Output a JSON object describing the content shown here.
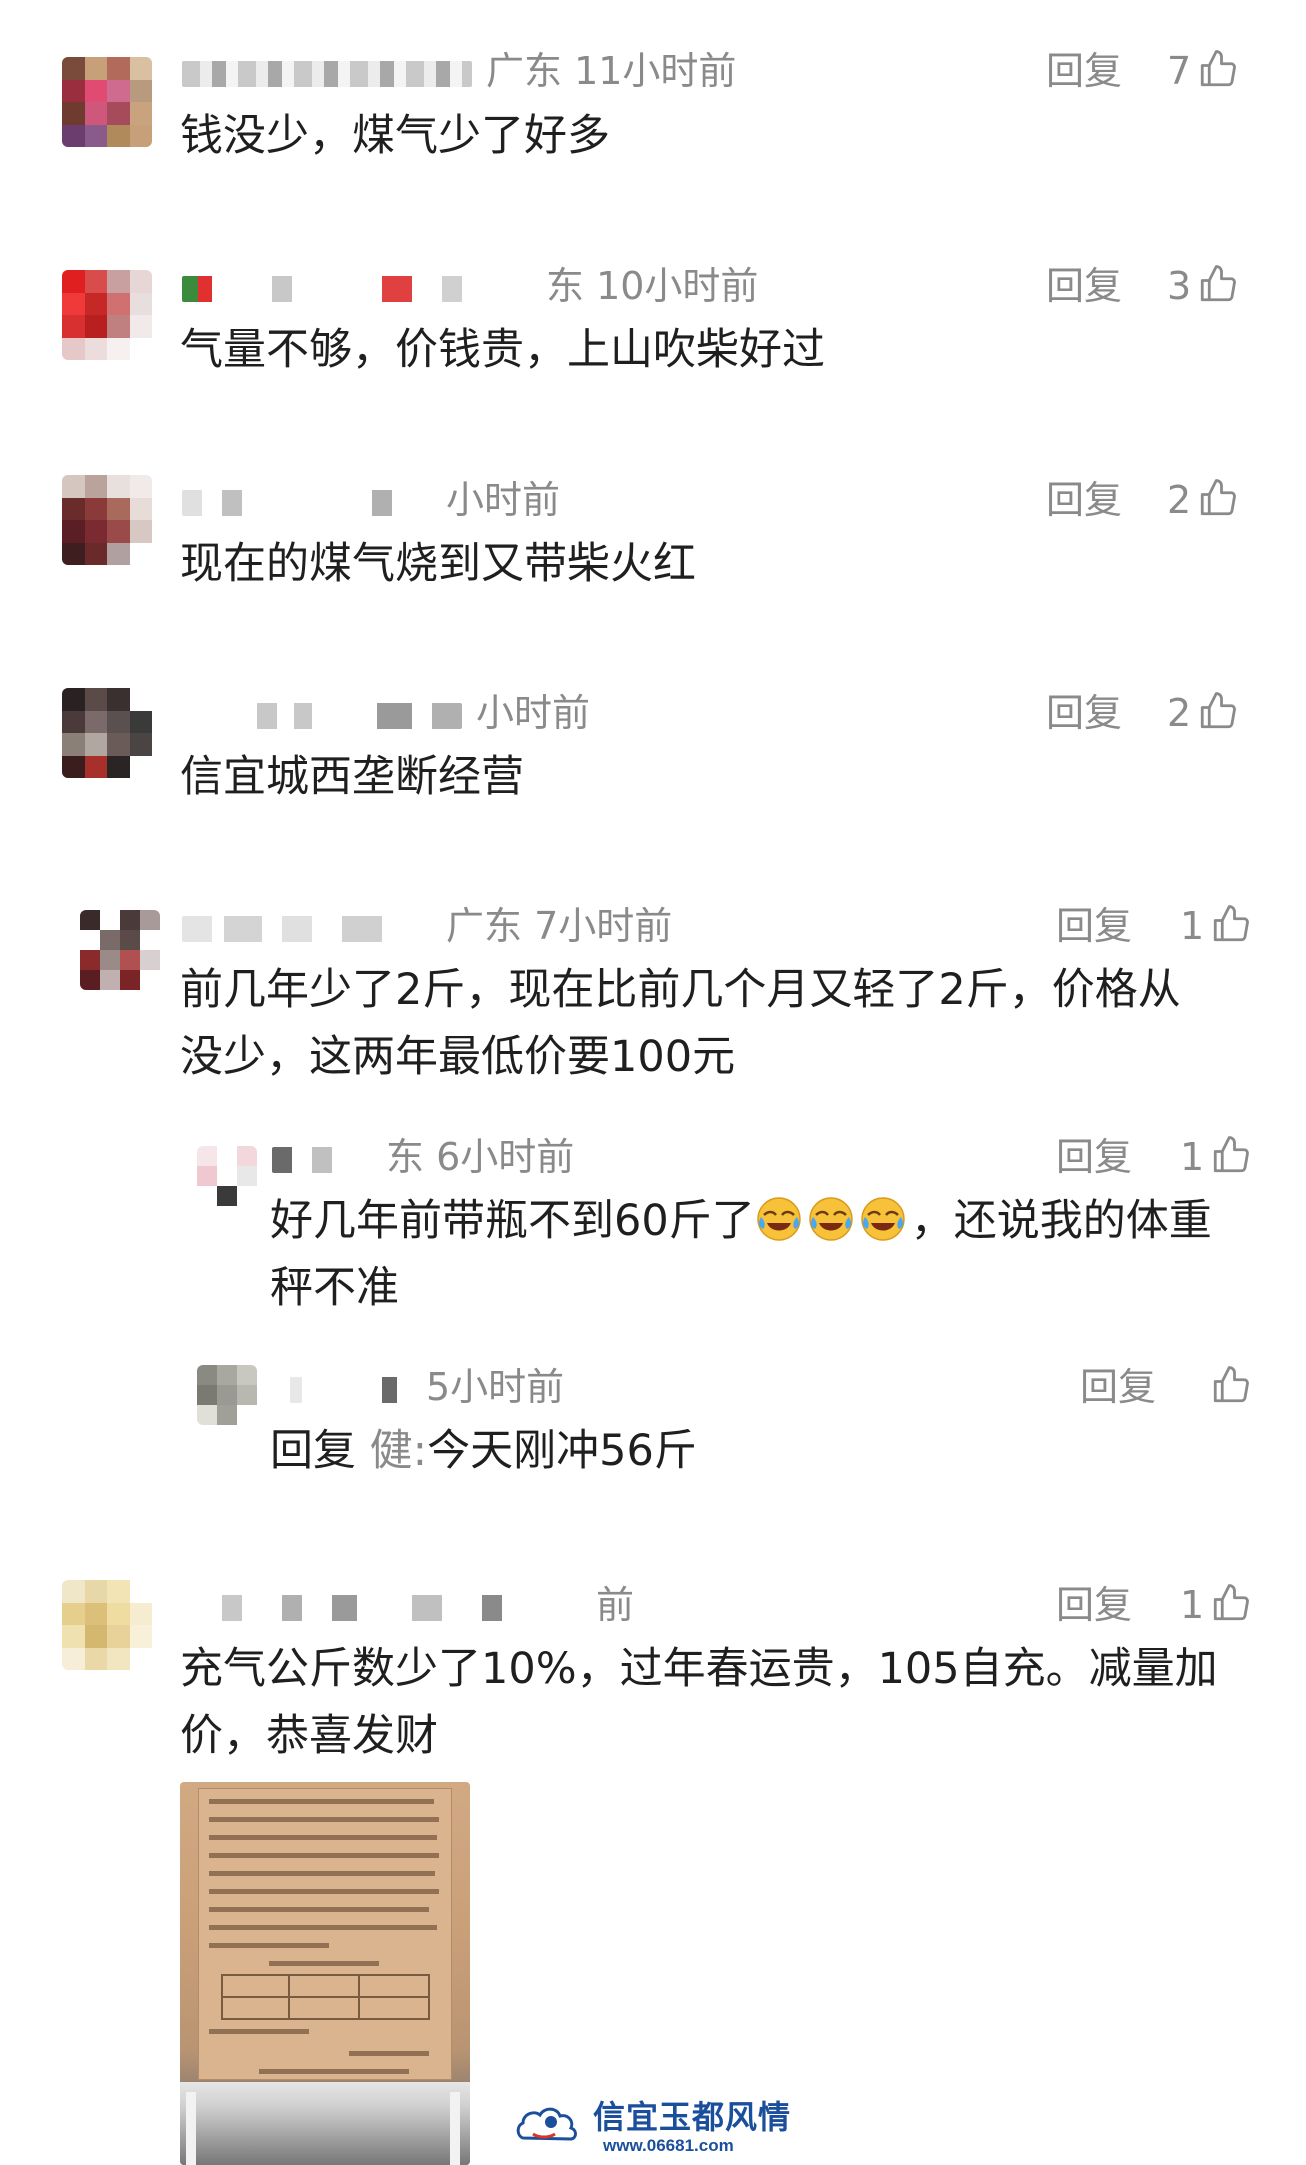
{
  "ui": {
    "reply_label": "回复"
  },
  "comments": [
    {
      "meta": "广东 11小时前",
      "likes": "7",
      "text": "钱没少，煤气少了好多"
    },
    {
      "meta": "东 10小时前",
      "likes": "3",
      "text": "气量不够，价钱贵，上山吹柴好过"
    },
    {
      "meta": "小时前",
      "likes": "2",
      "text": "现在的煤气烧到又带柴火红"
    },
    {
      "meta": "小时前",
      "likes": "2",
      "text": "信宜城西垄断经营"
    },
    {
      "meta": "广东 7小时前",
      "likes": "1",
      "text_line1": "前几年少了2斤，现在比前几个月又轻了2斤，价格从",
      "text_line2": "没少，这两年最低价要100元",
      "replies": [
        {
          "meta": "东 6小时前",
          "likes": "1",
          "text_line1_before": "好几年前带瓶不到60斤了",
          "emoji": "crying-laughing",
          "emoji_count": 3,
          "text_line1_after": "，还说我的体重",
          "text_line2": "秤不准"
        },
        {
          "meta": "5小时前",
          "likes": "",
          "reply_prefix": "回复",
          "reply_target": "健:",
          "text": "今天刚冲56斤"
        }
      ]
    },
    {
      "meta": "前",
      "likes": "1",
      "text_line1": "充气公斤数少了10%，过年春运贵，105自充。减量加",
      "text_line2": "价，恭喜发财"
    }
  ],
  "watermark": {
    "title": "信宜玉都风情",
    "url": "www.06681.com"
  },
  "colors": {
    "text": "#1f1f1f",
    "meta": "#8a8a8a",
    "brand_blue": "#1b4f9c"
  }
}
